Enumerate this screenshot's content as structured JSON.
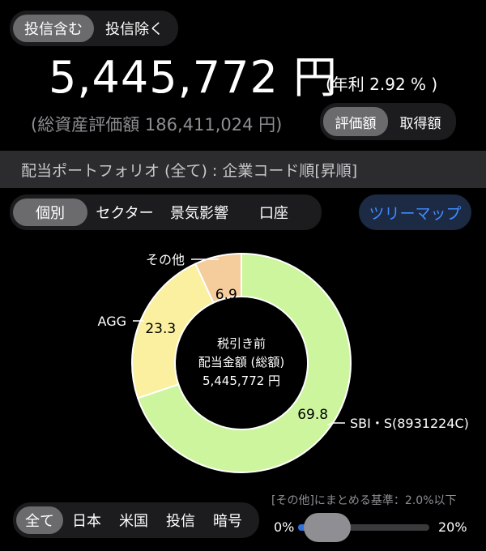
{
  "top_toggle": {
    "options": [
      "投信含む",
      "投信除く"
    ],
    "selected": 0
  },
  "summary": {
    "main_value": "5,445,772 円",
    "annual_rate": "(年利 2.92 % )",
    "total_assets": "(総資産評価額 186,411,024 円)"
  },
  "value_toggle": {
    "options": [
      "評価額",
      "取得額"
    ],
    "selected": 0
  },
  "section_title": "配当ポートフォリオ (全て) : 企業コード順[昇順]",
  "view_tabs": {
    "options": [
      "個別",
      "セクター",
      "景気影響",
      "口座"
    ],
    "selected": 0
  },
  "treemap_button": "ツリーマップ",
  "chart_data": {
    "type": "pie",
    "center_text": [
      "税引き前",
      "配当金額 (総額)",
      "5,445,772 円"
    ],
    "slices": [
      {
        "name": "SBI・S(8931224C)",
        "value": 69.8,
        "value_label": "69.8",
        "color": "#ccf59e"
      },
      {
        "name": "AGG",
        "value": 23.3,
        "value_label": "23.3",
        "color": "#faf0a0"
      },
      {
        "name": "その他",
        "value": 6.9,
        "value_label": "6.9",
        "color": "#f5cd9c"
      }
    ]
  },
  "region_filter": {
    "options": [
      "全て",
      "日本",
      "米国",
      "投信",
      "暗号"
    ],
    "selected": 0
  },
  "threshold": {
    "label": "[その他]にまとめる基準：2.0%以下",
    "min_label": "0%",
    "max_label": "20%",
    "value_fraction": 0.1
  }
}
